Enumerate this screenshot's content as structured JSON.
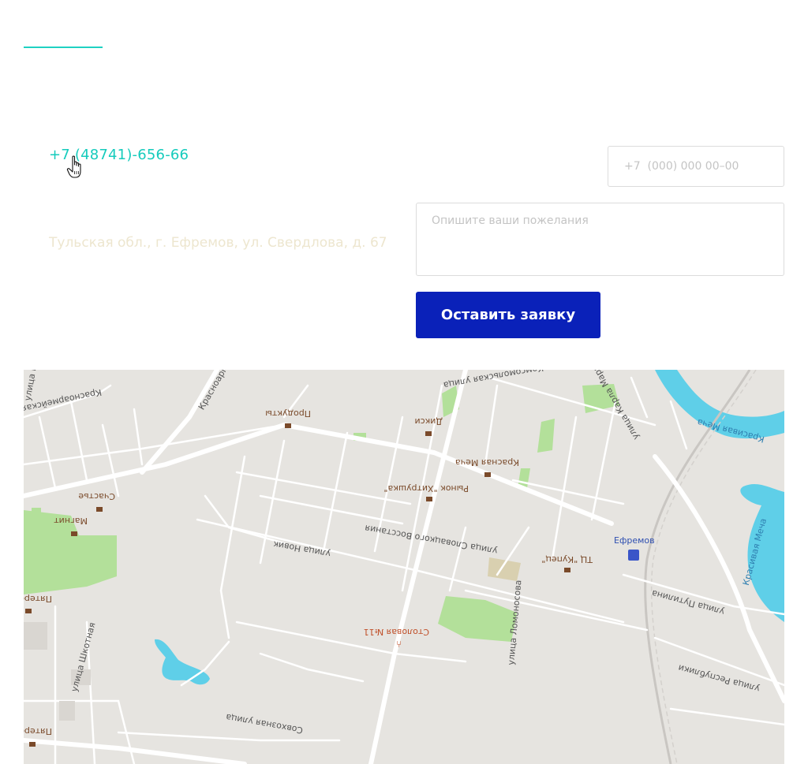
{
  "contacts": {
    "phone": "+7 (48741)-656-66",
    "address": "Тульская обл., г. Ефремов, ул. Свердлова, д. 67"
  },
  "form": {
    "phone_placeholder": "+7  (000) 000 00–00",
    "wishes_placeholder": "Опишите ваши пожелания",
    "submit_label": "Оставить заявку"
  },
  "colors": {
    "accent": "#15cbbc",
    "button": "#0a21b9",
    "map_land": "#e6e4e0",
    "map_park": "#b3e09a",
    "map_water": "#5fcfe8"
  },
  "map": {
    "labels": {
      "street_krasnoarmeyskaya": "Красноармейская улица",
      "street_komsomolskaya": "Комсомольская улица",
      "street_karla_marksa": "улица Карла Маркса",
      "street_slavyanskogo_vosstaniya": "улица Словацкого Восстания",
      "street_lomonosova": "улица Ломоносова",
      "street_novik": "улица Новик",
      "street_shkolnaya": "улица Шкотная",
      "street_sovkhoznaya": "Совхозная улица",
      "street_putilina": "улица Путилина",
      "street_respubliki": "улица Республики",
      "street_krasnoarm_short": "Красноарм",
      "street_short_left": "улица В",
      "river_krasivaya_mecha_1": "Красивая Меча",
      "river_krasivaya_mecha_2": "Красивая Меча",
      "poi_produkty": "Продукты",
      "poi_diksi": "Дикси",
      "poi_krasnaya_mecha": "Красная Меча",
      "poi_rynok": "Рынок \"Хитрушка\"",
      "poi_schastye": "Счастье",
      "poi_magnit": "Магнит",
      "poi_tc_kupets": "ТЦ \"Купец\"",
      "poi_efremov": "Ефремов",
      "poi_stolovaya": "Столовая №11",
      "poi_pyaterochka_1": "Пятерочка",
      "poi_pyaterochka_2": "Пятерочка"
    }
  }
}
